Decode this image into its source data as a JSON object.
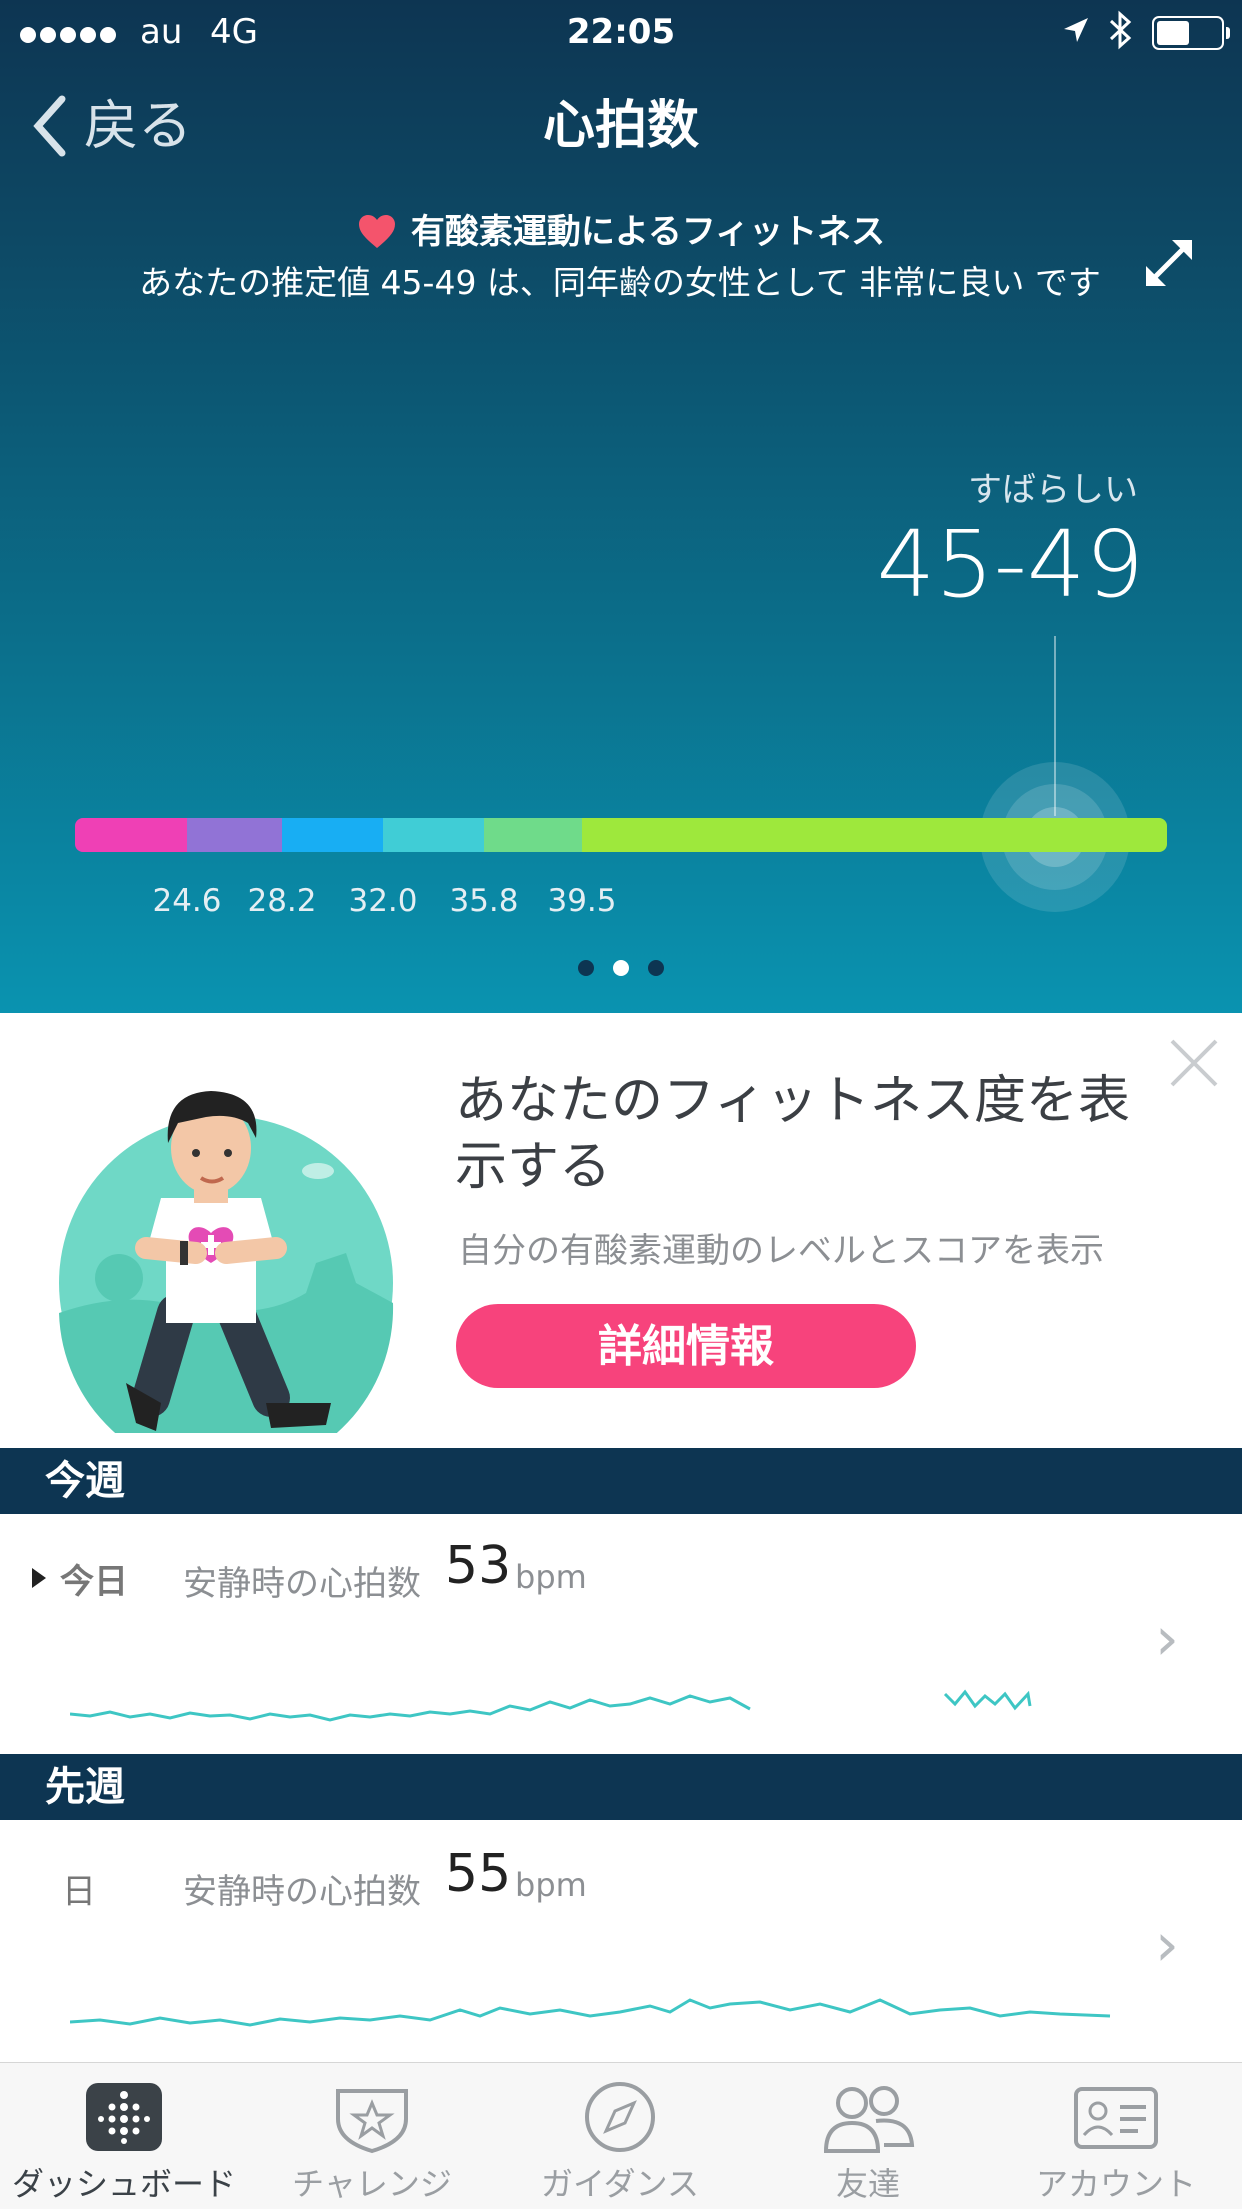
{
  "status_bar": {
    "carrier": "au",
    "network": "4G",
    "time": "22:05"
  },
  "nav": {
    "back_label": "戻る",
    "title": "心拍数"
  },
  "fitness": {
    "title": "有酸素運動によるフィットネス",
    "description": "あなたの推定値 45-49 は、同年齢の女性として 非常に良い です",
    "rating_label": "すばらしい",
    "rating_value": "45-49",
    "scale_ticks": [
      "24.6",
      "28.2",
      "32.0",
      "35.8",
      "39.5"
    ],
    "scale_colors": [
      "#ef40b5",
      "#9173d6",
      "#18aef3",
      "#40cdd6",
      "#6fdb8a",
      "#9ee83c"
    ],
    "pager_count": 3,
    "pager_active": 2
  },
  "promo": {
    "title": "あなたのフィットネス度を表示する",
    "subtitle": "自分の有酸素運動のレベルとスコアを表示",
    "button_label": "詳細情報"
  },
  "this_week": {
    "header": "今週",
    "day": "今日",
    "label": "安静時の心拍数",
    "value": "53",
    "unit": "bpm"
  },
  "last_week": {
    "header": "先週",
    "day": "日",
    "label": "安静時の心拍数",
    "value": "55",
    "unit": "bpm"
  },
  "tabs": [
    {
      "label": "ダッシュボード",
      "icon": "dashboard-icon",
      "active": true
    },
    {
      "label": "チャレンジ",
      "icon": "star-badge-icon",
      "active": false
    },
    {
      "label": "ガイダンス",
      "icon": "compass-icon",
      "active": false
    },
    {
      "label": "友達",
      "icon": "friends-icon",
      "active": false
    },
    {
      "label": "アカウント",
      "icon": "account-card-icon",
      "active": false
    }
  ]
}
